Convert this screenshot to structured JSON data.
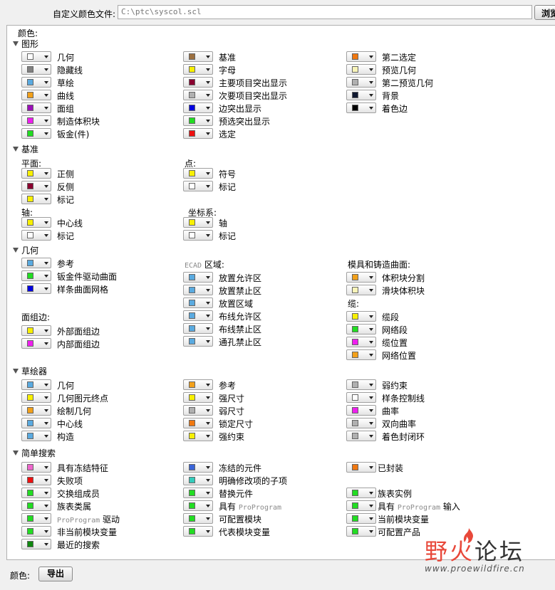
{
  "topbar": {
    "file_label": "自定义颜色文件:",
    "file_value": "C:\\ptc\\syscol.scl",
    "browse_label": "浏览"
  },
  "panel": {
    "title": "颜色:"
  },
  "sections": {
    "graphics": "图形",
    "datum": "基准",
    "geometry": "几何",
    "sketcher": "草绘器",
    "simple_search": "简单搜索"
  },
  "graphics": {
    "col1": [
      {
        "label": "几何",
        "color": "#ffffff"
      },
      {
        "label": "隐藏线",
        "color": "#808080"
      },
      {
        "label": "草绘",
        "color": "#5aaae0"
      },
      {
        "label": "曲线",
        "color": "#f2a01a"
      },
      {
        "label": "面组",
        "color": "#9b10b8"
      },
      {
        "label": "制造体积块",
        "color": "#ee1fee"
      },
      {
        "label": "钣金(件)",
        "color": "#22dd22"
      }
    ],
    "col2": [
      {
        "label": "基准",
        "color": "#9c7040"
      },
      {
        "label": "字母",
        "color": "#f8f000"
      },
      {
        "label": "主要项目突出显示",
        "color": "#8a0030"
      },
      {
        "label": "次要项目突出显示",
        "color": "#b0b0b0"
      },
      {
        "label": "边突出显示",
        "color": "#0000e0"
      },
      {
        "label": "预选突出显示",
        "color": "#22dd22"
      },
      {
        "label": "选定",
        "color": "#ee1010"
      }
    ],
    "col3": [
      {
        "label": "第二选定",
        "color": "#f07810"
      },
      {
        "label": "预览几何",
        "color": "#f8f4b8"
      },
      {
        "label": "第二预览几何",
        "color": "#b0b0b0"
      },
      {
        "label": "背景",
        "color": "#101830"
      },
      {
        "label": "着色边",
        "color": "#000000"
      }
    ]
  },
  "datum": {
    "plane_label": "平面:",
    "plane": [
      {
        "label": "正侧",
        "color": "#f8f000"
      },
      {
        "label": "反侧",
        "color": "#8a0030"
      },
      {
        "label": "标记",
        "color": "#f8f000"
      }
    ],
    "point_label": "点:",
    "point": [
      {
        "label": "符号",
        "color": "#f8f000"
      },
      {
        "label": "标记",
        "color": "#ffffff"
      }
    ],
    "axis_label": "轴:",
    "axis": [
      {
        "label": "中心线",
        "color": "#f8f000"
      },
      {
        "label": "标记",
        "color": "#ffffff"
      }
    ],
    "csys_label": "坐标系:",
    "csys": [
      {
        "label": "轴",
        "color": "#f8f000"
      },
      {
        "label": "标记",
        "color": "#ffffff"
      }
    ]
  },
  "geometry": {
    "col1": [
      {
        "label": "参考",
        "color": "#5aaae0"
      },
      {
        "label": "钣金件驱动曲面",
        "color": "#22dd22"
      },
      {
        "label": "样条曲面网格",
        "color": "#0000e0"
      }
    ],
    "quilt_edge_label": "面组边:",
    "quilt_edge": [
      {
        "label": "外部面组边",
        "color": "#f8f000"
      },
      {
        "label": "内部面组边",
        "color": "#ee1fee"
      }
    ],
    "ecad_prefix": "ECAD",
    "ecad_suffix": " 区域:",
    "ecad": [
      {
        "label": "放置允许区",
        "color": "#5aaae0"
      },
      {
        "label": "放置禁止区",
        "color": "#5aaae0"
      },
      {
        "label": "放置区域",
        "color": "#5aaae0"
      },
      {
        "label": "布线允许区",
        "color": "#5aaae0"
      },
      {
        "label": "布线禁止区",
        "color": "#5aaae0"
      },
      {
        "label": "通孔禁止区",
        "color": "#5aaae0"
      }
    ],
    "mold_label": "模具和铸造曲面:",
    "mold": [
      {
        "label": "体积块分割",
        "color": "#f2a01a"
      },
      {
        "label": "滑块体积块",
        "color": "#f8f4b8"
      }
    ],
    "cable_label": "缆:",
    "cable": [
      {
        "label": "缆段",
        "color": "#f8f000"
      },
      {
        "label": "网络段",
        "color": "#22dd22"
      },
      {
        "label": "缆位置",
        "color": "#ee1fee"
      },
      {
        "label": "网络位置",
        "color": "#f2a01a"
      }
    ]
  },
  "sketcher": {
    "col1": [
      {
        "label": "几何",
        "color": "#5aaae0"
      },
      {
        "label": "几何图元终点",
        "color": "#f8f000"
      },
      {
        "label": "绘制几何",
        "color": "#f2a01a"
      },
      {
        "label": "中心线",
        "color": "#5aaae0"
      },
      {
        "label": "构造",
        "color": "#5aaae0"
      }
    ],
    "col2": [
      {
        "label": "参考",
        "color": "#f2a01a"
      },
      {
        "label": "强尺寸",
        "color": "#f8f000"
      },
      {
        "label": "弱尺寸",
        "color": "#b0b0b0"
      },
      {
        "label": "锁定尺寸",
        "color": "#f07810"
      },
      {
        "label": "强约束",
        "color": "#f8f000"
      }
    ],
    "col3": [
      {
        "label": "弱约束",
        "color": "#b0b0b0"
      },
      {
        "label": "样条控制线",
        "color": "#ffffff"
      },
      {
        "label": "曲率",
        "color": "#ee1fee"
      },
      {
        "label": "双向曲率",
        "color": "#b0b0b0"
      },
      {
        "label": "着色封闭环",
        "color": "#b0b0b0"
      }
    ]
  },
  "simple_search": {
    "col1": [
      {
        "label": "具有冻结特征",
        "color": "#ee66cc"
      },
      {
        "label": "失败项",
        "color": "#ee1010"
      },
      {
        "label": "交换组成员",
        "color": "#22dd22"
      },
      {
        "label": "族表类属",
        "color": "#22dd22"
      },
      {
        "label": "ProProgram",
        "suffix": " 驱动",
        "color": "#22dd22"
      },
      {
        "label": "非当前模块变量",
        "color": "#22dd22"
      },
      {
        "label": "最近的搜索",
        "color": "#108810"
      }
    ],
    "col2": [
      {
        "label": "冻结的元件",
        "color": "#3a64d8"
      },
      {
        "label": "明确修改项的子项",
        "color": "#33ccbb"
      },
      {
        "label": "替换元件",
        "color": "#22dd22"
      },
      {
        "prefix": "具有 ",
        "label": "ProProgram",
        "color": "#22dd22"
      },
      {
        "label": "可配置模块",
        "color": "#22dd22"
      },
      {
        "label": "代表模块变量",
        "color": "#22dd22"
      }
    ],
    "col3": [
      {
        "label": "已封装",
        "color": "#f07810"
      },
      {
        "label": "族表实例",
        "color": "#22dd22"
      },
      {
        "prefix": "具有 ",
        "label": "ProProgram",
        "suffix": " 输入",
        "color": "#22dd22"
      },
      {
        "label": "当前模块变量",
        "color": "#22dd22"
      },
      {
        "label": "可配置产品",
        "color": "#22dd22"
      }
    ]
  },
  "footer": {
    "color_label": "颜色:",
    "export_label": "导出"
  },
  "watermark": {
    "cn1": "野火",
    "cn2": "论坛",
    "url": "www.proewildfire.cn"
  }
}
